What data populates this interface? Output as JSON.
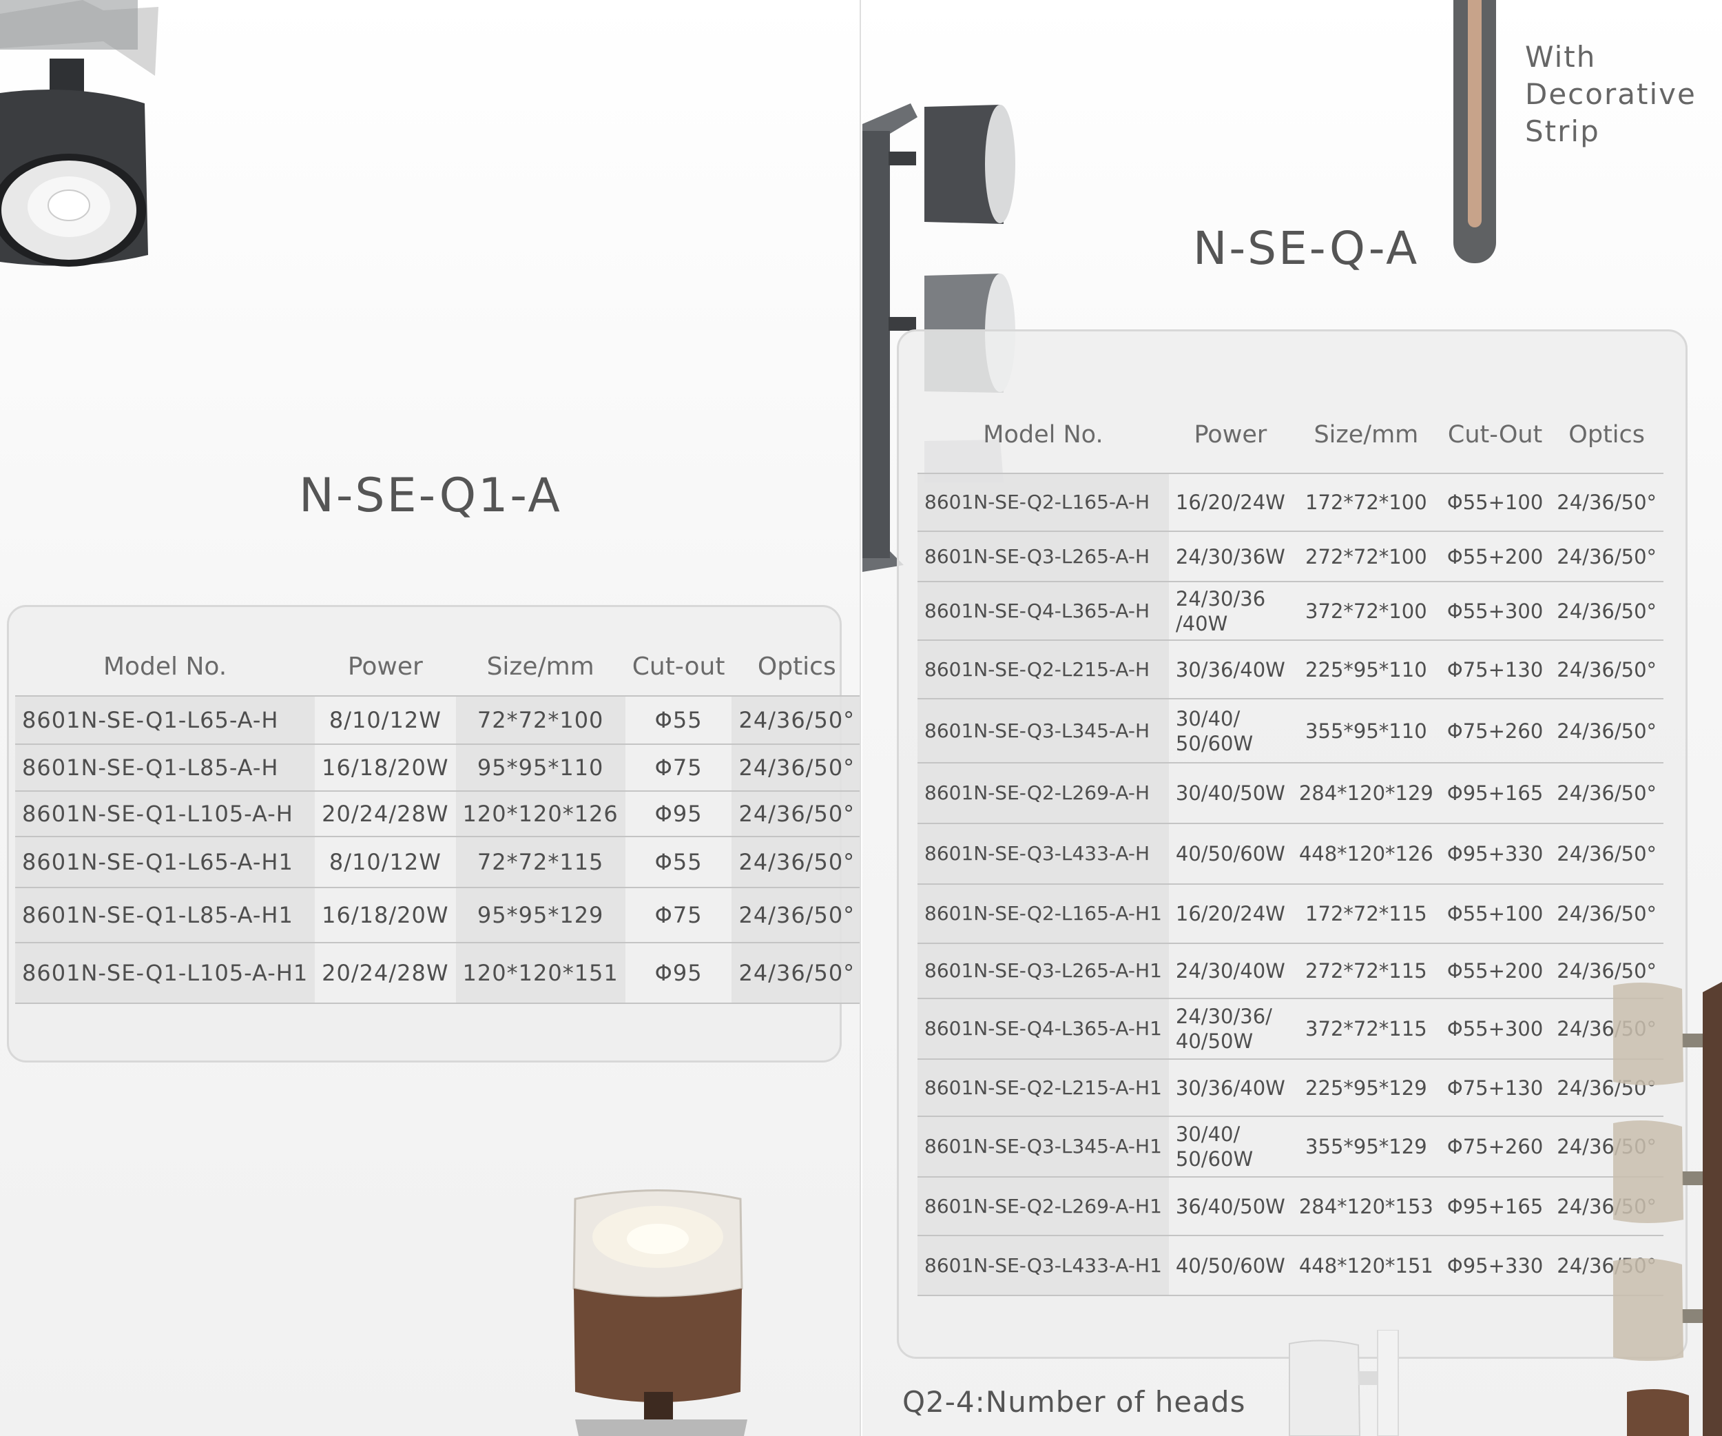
{
  "left_page": {
    "title": "N-SE-Q1-A",
    "table": {
      "headers": [
        "Model No.",
        "Power",
        "Size/mm",
        "Cut-out",
        "Optics"
      ],
      "rows": [
        [
          "8601N-SE-Q1-L65-A-H",
          "8/10/12W",
          "72*72*100",
          "Φ55",
          "24/36/50°"
        ],
        [
          "8601N-SE-Q1-L85-A-H",
          "16/18/20W",
          "95*95*110",
          "Φ75",
          "24/36/50°"
        ],
        [
          "8601N-SE-Q1-L105-A-H",
          "20/24/28W",
          "120*120*126",
          "Φ95",
          "24/36/50°"
        ],
        [
          "8601N-SE-Q1-L65-A-H1",
          "8/10/12W",
          "72*72*115",
          "Φ55",
          "24/36/50°"
        ],
        [
          "8601N-SE-Q1-L85-A-H1",
          "16/18/20W",
          "95*95*129",
          "Φ75",
          "24/36/50°"
        ],
        [
          "8601N-SE-Q1-L105-A-H1",
          "20/24/28W",
          "120*120*151",
          "Φ95",
          "24/36/50°"
        ]
      ]
    }
  },
  "right_page": {
    "decorative_text": [
      "With",
      "Decorative",
      "Strip"
    ],
    "title": "N-SE-Q-A",
    "table": {
      "headers": [
        "Model No.",
        "Power",
        "Size/mm",
        "Cut-Out",
        "Optics"
      ],
      "rows": [
        [
          "8601N-SE-Q2-L165-A-H",
          "16/20/24W",
          "172*72*100",
          "Φ55+100",
          "24/36/50°"
        ],
        [
          "8601N-SE-Q3-L265-A-H",
          "24/30/36W",
          "272*72*100",
          "Φ55+200",
          "24/36/50°"
        ],
        [
          "8601N-SE-Q4-L365-A-H",
          "24/30/36 /40W",
          "372*72*100",
          "Φ55+300",
          "24/36/50°"
        ],
        [
          "8601N-SE-Q2-L215-A-H",
          "30/36/40W",
          "225*95*110",
          "Φ75+130",
          "24/36/50°"
        ],
        [
          "8601N-SE-Q3-L345-A-H",
          "30/40/ 50/60W",
          "355*95*110",
          "Φ75+260",
          "24/36/50°"
        ],
        [
          "8601N-SE-Q2-L269-A-H",
          "30/40/50W",
          "284*120*129",
          "Φ95+165",
          "24/36/50°"
        ],
        [
          "8601N-SE-Q3-L433-A-H",
          "40/50/60W",
          "448*120*126",
          "Φ95+330",
          "24/36/50°"
        ],
        [
          "8601N-SE-Q2-L165-A-H1",
          "16/20/24W",
          "172*72*115",
          "Φ55+100",
          "24/36/50°"
        ],
        [
          "8601N-SE-Q3-L265-A-H1",
          "24/30/40W",
          "272*72*115",
          "Φ55+200",
          "24/36/50°"
        ],
        [
          "8601N-SE-Q4-L365-A-H1",
          "24/30/36/ 40/50W",
          "372*72*115",
          "Φ55+300",
          "24/36/50°"
        ],
        [
          "8601N-SE-Q2-L215-A-H1",
          "30/36/40W",
          "225*95*129",
          "Φ75+130",
          "24/36/50°"
        ],
        [
          "8601N-SE-Q3-L345-A-H1",
          "30/40/ 50/60W",
          "355*95*129",
          "Φ75+260",
          "24/36/50°"
        ],
        [
          "8601N-SE-Q2-L269-A-H1",
          "36/40/50W",
          "284*120*153",
          "Φ95+165",
          "24/36/50°"
        ],
        [
          "8601N-SE-Q3-L433-A-H1",
          "40/50/60W",
          "448*120*151",
          "Φ95+330",
          "24/36/50°"
        ]
      ]
    },
    "footnote": "Q2-4:Number of heads"
  },
  "colors": {
    "dark_housing": "#3b3d40",
    "bronze_housing": "#6e4a36",
    "strip_gold": "#c7a38a",
    "strip_grey": "#5f6163"
  }
}
